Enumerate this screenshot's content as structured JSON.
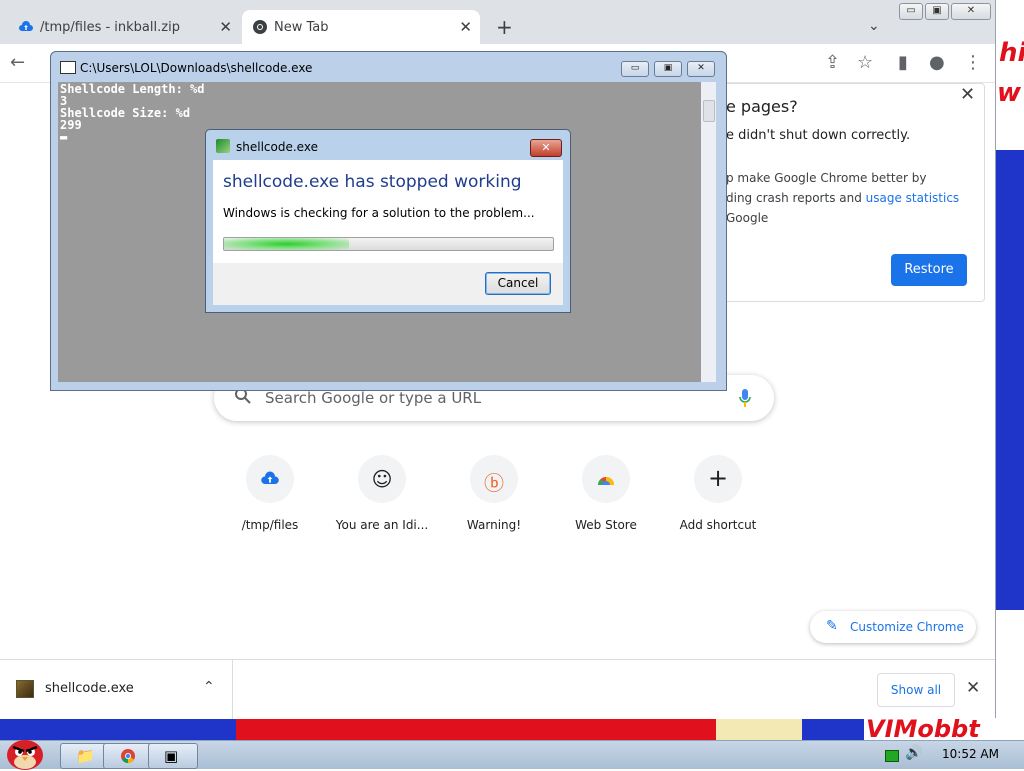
{
  "chrome": {
    "tabs": [
      {
        "title": "/tmp/files - inkball.zip"
      },
      {
        "title": "New Tab"
      }
    ],
    "new_tab_symbol": "+",
    "close_symbol": "✕",
    "tab_search_symbol": "⌄",
    "window_buttons": {
      "minimize": "▭",
      "maximize": "▣",
      "close": "✕"
    },
    "toolbar_icons": [
      "back-arrow-icon",
      "share-icon",
      "star-icon",
      "side-panel-icon",
      "profile-icon",
      "more-icon"
    ],
    "toolbar_glyphs": {
      "back": "←",
      "share": "⇪",
      "star": "☆",
      "side_panel": "▮",
      "profile": "●",
      "more": "⋮"
    }
  },
  "restore_panel": {
    "title": "e pages?",
    "message": "e didn't shut down correctly.",
    "desc_line1": "p make Google Chrome better by",
    "desc_line2_prefix": "ding crash reports and ",
    "desc_line2_link": "usage statistics",
    "desc_line3": "Google",
    "restore_label": "Restore",
    "close_symbol": "✕"
  },
  "ntp": {
    "search_placeholder": "Search Google or type a URL",
    "shortcuts": [
      {
        "label": "/tmp/files",
        "icon": "cloud-upload-icon",
        "glyph": "☁"
      },
      {
        "label": "You are an Idi...",
        "icon": "smiley-icon",
        "glyph": "☺"
      },
      {
        "label": "Warning!",
        "icon": "bitly-icon",
        "glyph": "ⓑ"
      },
      {
        "label": "Web Store",
        "icon": "web-store-icon",
        "glyph": "◓"
      },
      {
        "label": "Add shortcut",
        "icon": "plus-icon",
        "glyph": "+"
      }
    ],
    "customize_label": "Customize Chrome",
    "customize_glyph": "✎"
  },
  "download_bar": {
    "file_name": "shellcode.exe",
    "chevron": "⌃",
    "show_all_label": "Show all",
    "close_symbol": "✕"
  },
  "console": {
    "title": "C:\\Users\\LOL\\Downloads\\shellcode.exe",
    "output": "Shellcode Length: %d\n3\nShellcode Size: %d\n299\n▬",
    "buttons": {
      "minimize": "▭",
      "maximize": "▣",
      "close": "✕"
    }
  },
  "error_dialog": {
    "title": "shellcode.exe",
    "heading": "shellcode.exe has stopped working",
    "message": "Windows is checking for a solution to the problem...",
    "progress": 0.38,
    "cancel_label": "Cancel",
    "close_symbol": "✕"
  },
  "wallpaper": {
    "text_right_1": "hit",
    "text_right_2": "w",
    "text_bottom": "VIMobbt"
  },
  "taskbar": {
    "clock": "10:52 AM",
    "tasks": [
      {
        "icon": "explorer-icon",
        "glyph": "📁"
      },
      {
        "icon": "chrome-icon",
        "glyph": "◉"
      },
      {
        "icon": "console-icon",
        "glyph": "▣"
      }
    ],
    "volume_glyph": "🔊"
  },
  "colors": {
    "chrome_blue": "#1a73e8",
    "dialog_heading": "#1e3d8c",
    "wall_red": "#e0101c",
    "wall_blue": "#1f35c9"
  }
}
